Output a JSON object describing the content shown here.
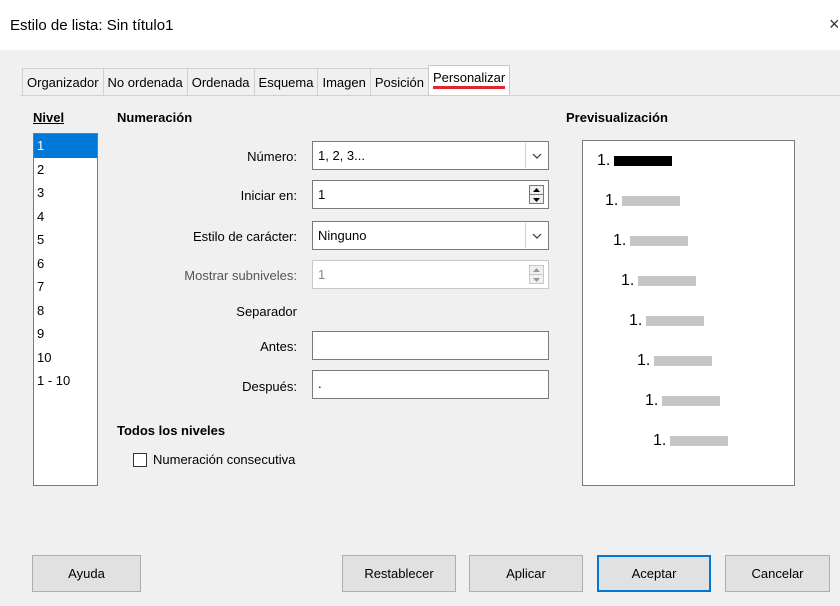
{
  "window": {
    "title": "Estilo de lista: Sin título1",
    "close_glyph": "×"
  },
  "tabs": [
    {
      "label": "Organizador",
      "active": false
    },
    {
      "label": "No ordenada",
      "active": false
    },
    {
      "label": "Ordenada",
      "active": false
    },
    {
      "label": "Esquema",
      "active": false
    },
    {
      "label": "Imagen",
      "active": false
    },
    {
      "label": "Posición",
      "active": false
    },
    {
      "label": "Personalizar",
      "active": true
    }
  ],
  "level": {
    "heading": "Nivel",
    "items": [
      "1",
      "2",
      "3",
      "4",
      "5",
      "6",
      "7",
      "8",
      "9",
      "10",
      "1 - 10"
    ],
    "selected": "1"
  },
  "numbering": {
    "heading": "Numeración",
    "number_label": "Número:",
    "number_value": "1, 2, 3...",
    "start_label": "Iniciar en:",
    "start_value": "1",
    "char_style_label": "Estilo de carácter:",
    "char_style_value": "Ninguno",
    "sublevels_label": "Mostrar subniveles:",
    "sublevels_value": "1",
    "separator_label": "Separador",
    "before_label": "Antes:",
    "before_value": "",
    "after_label": "Después:",
    "after_value": "."
  },
  "all_levels": {
    "heading": "Todos los niveles",
    "consecutive_label": "Numeración consecutiva",
    "consecutive_checked": false
  },
  "preview": {
    "heading": "Previsualización",
    "items": [
      "1.",
      "1.",
      "1.",
      "1.",
      "1.",
      "1.",
      "1.",
      "1."
    ]
  },
  "buttons": {
    "help": "Ayuda",
    "reset": "Restablecer",
    "apply": "Aplicar",
    "ok": "Aceptar",
    "cancel": "Cancelar"
  },
  "colors": {
    "selection": "#0078d7",
    "tab_underline": "#e0262f",
    "preview_bar": "#c6c6c6"
  }
}
